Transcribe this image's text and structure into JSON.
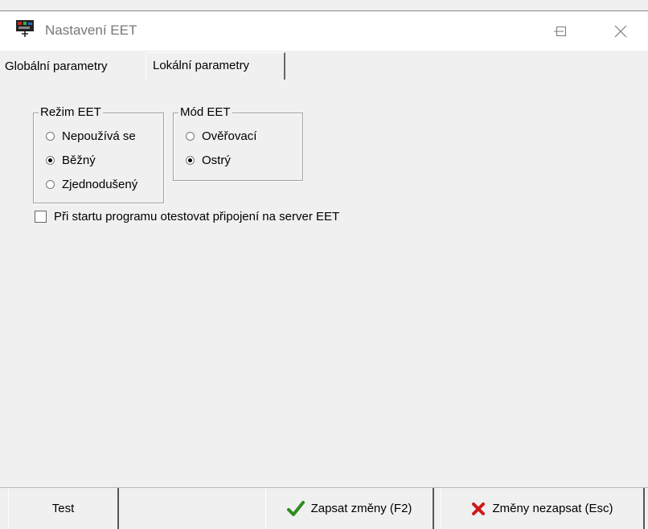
{
  "window": {
    "title": "Nastavení EET",
    "controls": [
      "minimize",
      "maximize",
      "close"
    ]
  },
  "tabs": [
    {
      "label": "Globální parametry",
      "active": false
    },
    {
      "label": "Lokální parametry",
      "active": true
    }
  ],
  "rezim": {
    "title": "Režim EET",
    "options": [
      {
        "label": "Nepoužívá se",
        "checked": false
      },
      {
        "label": "Běžný",
        "checked": true
      },
      {
        "label": "Zjednodušený",
        "checked": false
      }
    ]
  },
  "mod": {
    "title": "Mód EET",
    "options": [
      {
        "label": "Ověřovací",
        "checked": false
      },
      {
        "label": "Ostrý",
        "checked": true
      }
    ]
  },
  "startup_check": {
    "label": "Při startu programu otestovat připojení na server EET",
    "checked": false
  },
  "buttons": {
    "test": "Test",
    "save": "Zapsat změny (F2)",
    "cancel": "Změny nezapsat (Esc)"
  },
  "colors": {
    "save_icon": "#2e8b1e",
    "cancel_icon": "#d01818"
  }
}
